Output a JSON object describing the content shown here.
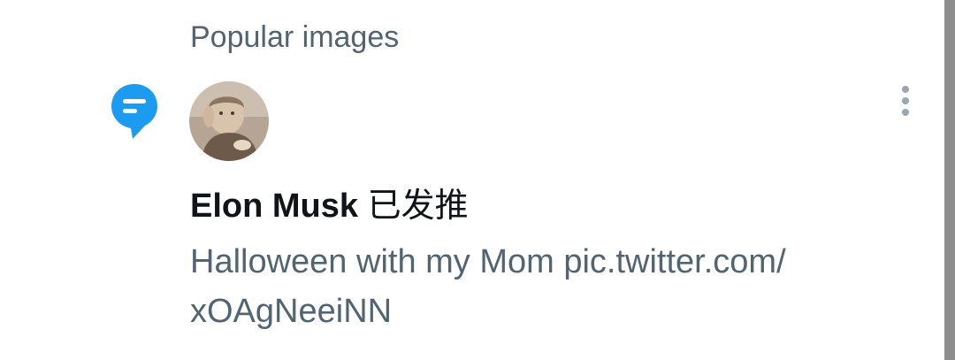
{
  "section": {
    "label": "Popular images"
  },
  "notification": {
    "icon": "chat-bubble-icon",
    "icon_color": "#1d9bf0",
    "avatar_alt": "profile-photo",
    "author": "Elon Musk",
    "action": "已发推",
    "text_line1": "Halloween with my Mom pic.twitter.com/",
    "text_line2": "xOAgNeeiNN"
  },
  "more_icon": "more-vertical-icon",
  "colors": {
    "primary_text": "#0f1419",
    "secondary_text": "#536471",
    "accent": "#1d9bf0"
  }
}
